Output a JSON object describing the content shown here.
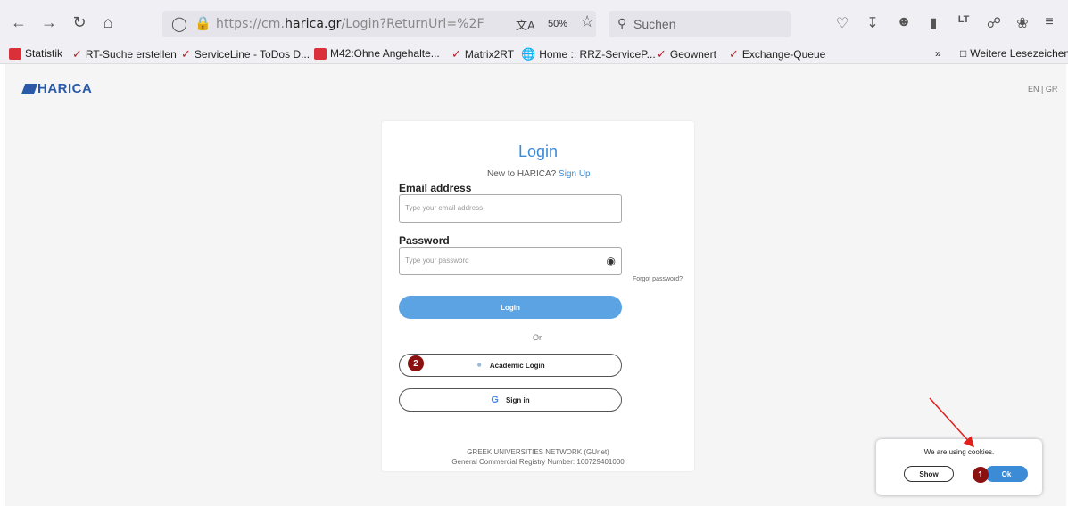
{
  "browser": {
    "url_prefix": "https://cm.",
    "url_domain": "harica.gr",
    "url_suffix": "/Login?ReturnUrl=%2F",
    "zoom": "50%",
    "search_placeholder": "Suchen"
  },
  "bookmarks": [
    {
      "label": "Statistik",
      "icon": "red-square"
    },
    {
      "label": "RT-Suche erstellen",
      "icon": "check"
    },
    {
      "label": "ServiceLine - ToDos D...",
      "icon": "check"
    },
    {
      "label": "M42:Ohne Angehalte...",
      "icon": "red-square"
    },
    {
      "label": "Matrix2RT",
      "icon": "check"
    },
    {
      "label": "Home :: RRZ-ServiceP...",
      "icon": "globe"
    },
    {
      "label": "Geownert",
      "icon": "check"
    },
    {
      "label": "Exchange-Queue",
      "icon": "check"
    }
  ],
  "bookmarks_more": "Weitere Lesezeichen",
  "site": {
    "logo": "HARICA",
    "lang": "EN | GR"
  },
  "login": {
    "title": "Login",
    "new_to": "New to HARICA?",
    "sign_up": "Sign Up",
    "email_label": "Email address",
    "email_placeholder": "Type your email address",
    "password_label": "Password",
    "password_placeholder": "Type your password",
    "forgot": "Forgot password?",
    "login_button": "Login",
    "or": "Or",
    "academic_button": "Academic Login",
    "google_button": "Sign in",
    "footer_line1": "GREEK UNIVERSITIES NETWORK (GUnet)",
    "footer_line2": "General Commercial Registry Number: 160729401000"
  },
  "cookies": {
    "text": "We are using cookies.",
    "show": "Show",
    "ok": "Ok"
  },
  "badges": [
    "1",
    "2"
  ],
  "colors": {
    "accent": "#3b8bd6",
    "brand": "#2a5aa7",
    "badge": "#8b1111",
    "arrow": "#e0201a"
  }
}
